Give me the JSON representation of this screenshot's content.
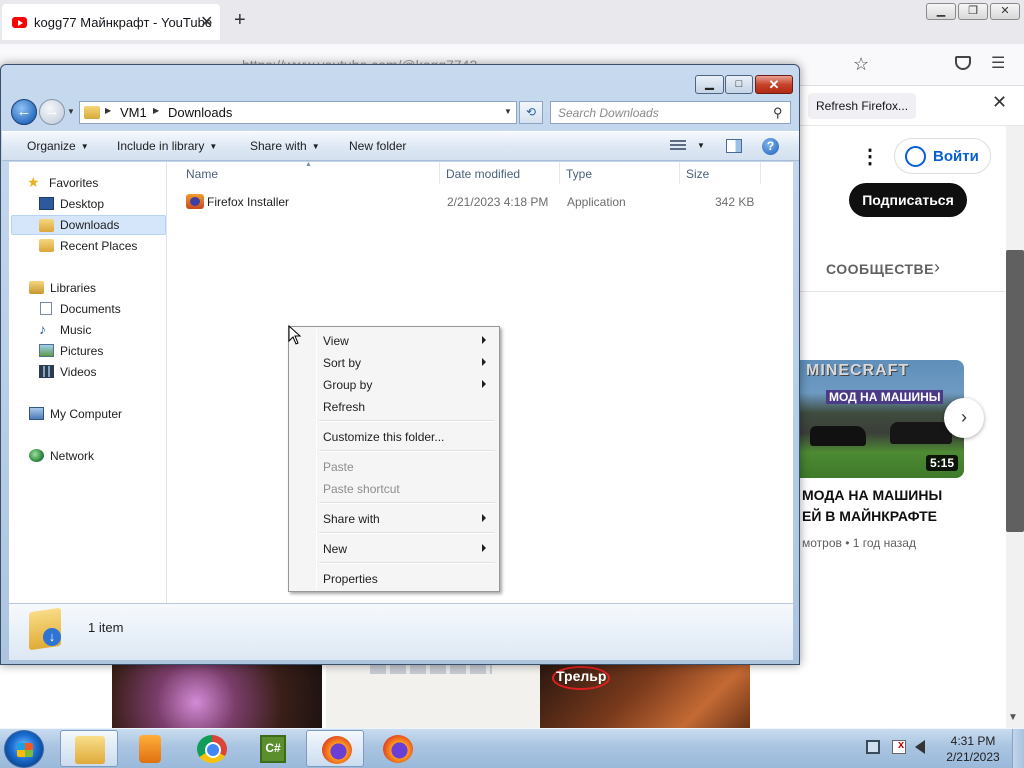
{
  "firefox": {
    "tab_title": "kogg77 Майнкрафт - YouTube",
    "tab_close": "✕",
    "new_tab": "+",
    "url": "https://www.youtube.com/@kogg7742",
    "refresh_firefox": "Refresh Firefox...",
    "notification_close": "✕",
    "window_min": "▁",
    "window_max": "❐",
    "window_close": "✕"
  },
  "youtube": {
    "more_menu": "⋮",
    "login": "Войти",
    "subscribe": "Подписаться",
    "community_tab": "СООБЩЕСТВЕ",
    "tab_next": "›",
    "video_overlay_title": "MINECRAFT",
    "video_overlay_sub": "МОД НА МАШИНЫ",
    "video_duration": "5:15",
    "video_title_line1": "МОДА НА МАШИНЫ",
    "video_title_line2": "ЕЙ В МАЙНКРАФТЕ",
    "video_meta": "мотров • 1 год назад",
    "next_arrow": "›",
    "bottom_thumb_label": "Трельр"
  },
  "explorer": {
    "window_min": "▁",
    "window_max": "□",
    "window_close": "✕",
    "breadcrumb": [
      "VM1",
      "Downloads"
    ],
    "search_placeholder": "Search Downloads",
    "toolbar": {
      "organize": "Organize",
      "include_in_library": "Include in library",
      "share_with": "Share with",
      "new_folder": "New folder",
      "help": "?"
    },
    "nav": {
      "favorites": "Favorites",
      "desktop": "Desktop",
      "downloads": "Downloads",
      "recent_places": "Recent Places",
      "libraries": "Libraries",
      "documents": "Documents",
      "music": "Music",
      "pictures": "Pictures",
      "videos": "Videos",
      "my_computer": "My Computer",
      "network": "Network"
    },
    "columns": [
      "Name",
      "Date modified",
      "Type",
      "Size"
    ],
    "files": [
      {
        "name": "Firefox Installer",
        "date_modified": "2/21/2023 4:18 PM",
        "type": "Application",
        "size": "342 KB"
      }
    ],
    "status": "1 item"
  },
  "context_menu": {
    "view": "View",
    "sort_by": "Sort by",
    "group_by": "Group by",
    "refresh": "Refresh",
    "customize": "Customize this folder...",
    "paste": "Paste",
    "paste_shortcut": "Paste shortcut",
    "share_with": "Share with",
    "new": "New",
    "properties": "Properties"
  },
  "taskbar": {
    "csharp_label": "C#",
    "time": "4:31 PM",
    "date": "2/21/2023"
  }
}
